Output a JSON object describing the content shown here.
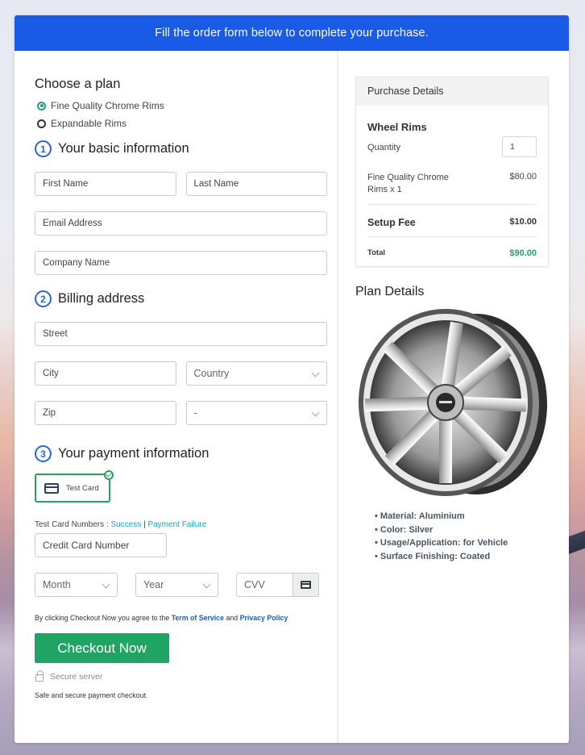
{
  "banner": {
    "text": "Fill the order form below to complete your purchase."
  },
  "plan": {
    "title": "Choose a plan",
    "options": [
      {
        "label": "Fine Quality Chrome Rims",
        "selected": true
      },
      {
        "label": "Expandable Rims",
        "selected": false
      }
    ]
  },
  "basic_info": {
    "step": "1",
    "title": "Your basic information",
    "first_name_placeholder": "First Name",
    "last_name_placeholder": "Last Name",
    "email_placeholder": "Email Address",
    "company_placeholder": "Company Name"
  },
  "billing": {
    "step": "2",
    "title": "Billing address",
    "street_placeholder": "Street",
    "city_placeholder": "City",
    "country_selected": "Country",
    "zip_placeholder": "Zip",
    "state_selected": "-"
  },
  "payment": {
    "step": "3",
    "title": "Your payment information",
    "method_label": "Test Card",
    "test_numbers_label": "Test Card Numbers :",
    "success_link": "Success",
    "separator": "|",
    "failure_link": "Payment Failure",
    "card_number_placeholder": "Credit Card Number",
    "month_selected": "Month",
    "year_selected": "Year",
    "cvv_placeholder": "CVV"
  },
  "agreement": {
    "prefix": "By clicking Checkout Now you agree to the",
    "terms_link": "Term of Service",
    "and": "and",
    "privacy_link": "Privacy Policy"
  },
  "checkout": {
    "button_label": "Checkout Now",
    "secure_label": "Secure server",
    "safe_text": "Safe and secure payment checkout."
  },
  "purchase_details": {
    "title": "Purchase Details",
    "product_name": "Wheel Rims",
    "quantity_label": "Quantity",
    "quantity_value": "1",
    "line_item_label": "Fine Quality Chrome Rims x 1",
    "line_item_amount": "$80.00",
    "setup_fee_label": "Setup Fee",
    "setup_fee_amount": "$10.00",
    "total_label": "Total",
    "total_amount": "$90.00"
  },
  "plan_details": {
    "title": "Plan Details",
    "image_alt": "chrome-wheel-rim",
    "specs": [
      "Material: Aluminium",
      "Color: Silver",
      "Usage/Application: for Vehicle",
      "Surface Finishing: Coated"
    ]
  },
  "colors": {
    "banner_blue": "#1a5be6",
    "checkout_green": "#1fa463",
    "total_green": "#1fa463",
    "link_teal": "#1fa1b8",
    "link_blue": "#1f5bb5",
    "step_blue": "#2a63e0"
  }
}
